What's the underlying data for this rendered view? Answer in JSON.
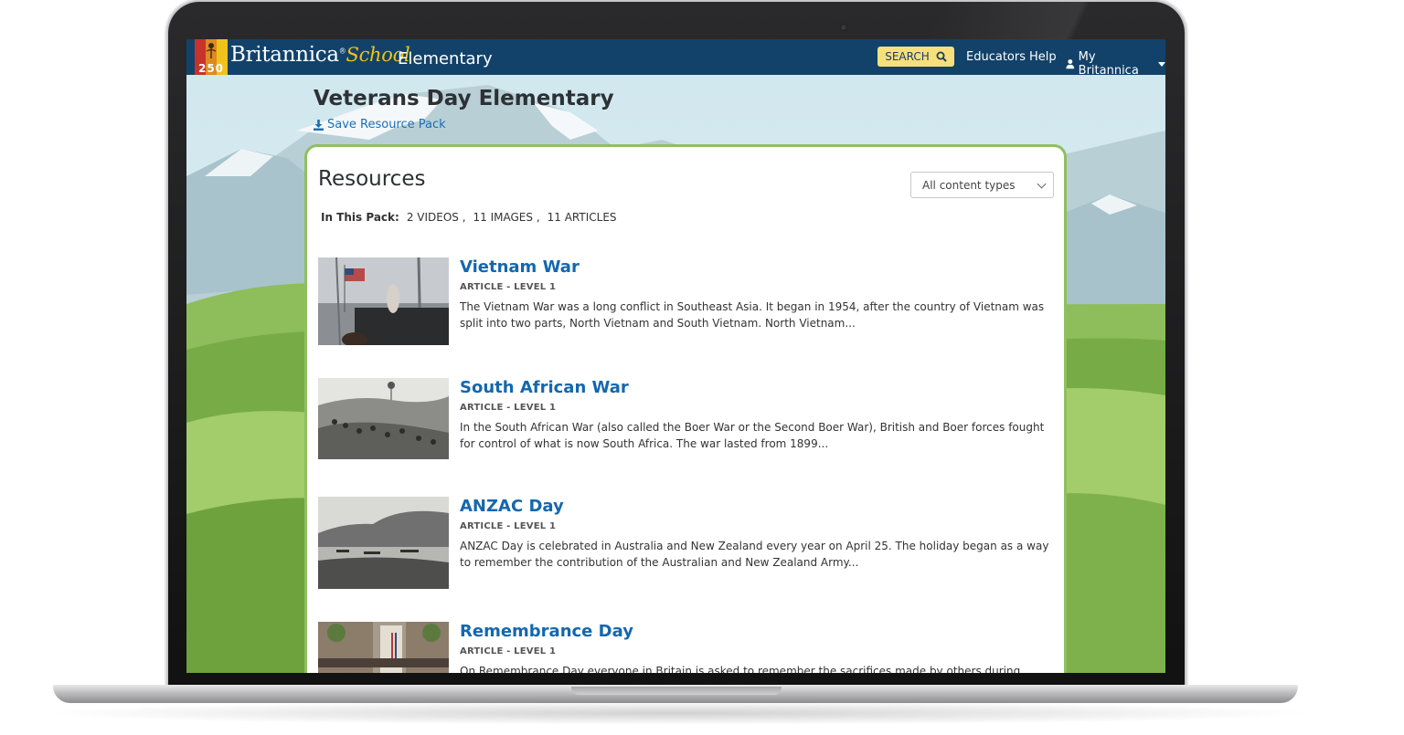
{
  "header": {
    "logo_number": "250",
    "brand_name": "Britannica",
    "brand_reg": "®",
    "brand_school": "School",
    "brand_level": "Elementary",
    "search_label": "SEARCH",
    "educators_label": "Educators",
    "help_label": "Help",
    "account_label": "My Britannica"
  },
  "page": {
    "title": "Veterans Day Elementary",
    "save_label": "Save Resource Pack"
  },
  "resources": {
    "heading": "Resources",
    "filter_selected": "All content types",
    "summary_label": "In This Pack:",
    "summary_videos": "2  VIDEOS ,",
    "summary_images": "11  IMAGES ,",
    "summary_articles": "11  ARTICLES",
    "items": [
      {
        "title": "Vietnam War",
        "meta": "ARTICLE - LEVEL 1",
        "description": "The Vietnam War was a long conflict in Southeast Asia. It began in 1954, after the country of Vietnam was split into two parts, North Vietnam and South Vietnam. North Vietnam..."
      },
      {
        "title": "South African War",
        "meta": "ARTICLE - LEVEL 1",
        "description": "In the South African War (also called the Boer War or the Second Boer War), British and Boer forces fought for control of what is now South Africa. The war lasted from 1899..."
      },
      {
        "title": "ANZAC Day",
        "meta": "ARTICLE - LEVEL 1",
        "description": "ANZAC Day is celebrated in Australia and New Zealand every year on April 25. The holiday began as a way to remember the contribution of the Australian and New Zealand Army..."
      },
      {
        "title": "Remembrance Day",
        "meta": "ARTICLE - LEVEL 1",
        "description": "On Remembrance Day everyone in Britain is asked to remember the sacrifices made by others during times of war..."
      }
    ]
  },
  "colors": {
    "header_bg": "#12426a",
    "accent_link": "#1467ae",
    "search_bg": "#f7e07b",
    "card_border": "#8fbf5f",
    "brand_school": "#f3c313"
  },
  "icons": [
    "search-icon",
    "download-icon",
    "user-icon",
    "caret-down-icon",
    "chevron-down-icon",
    "camera-icon"
  ]
}
